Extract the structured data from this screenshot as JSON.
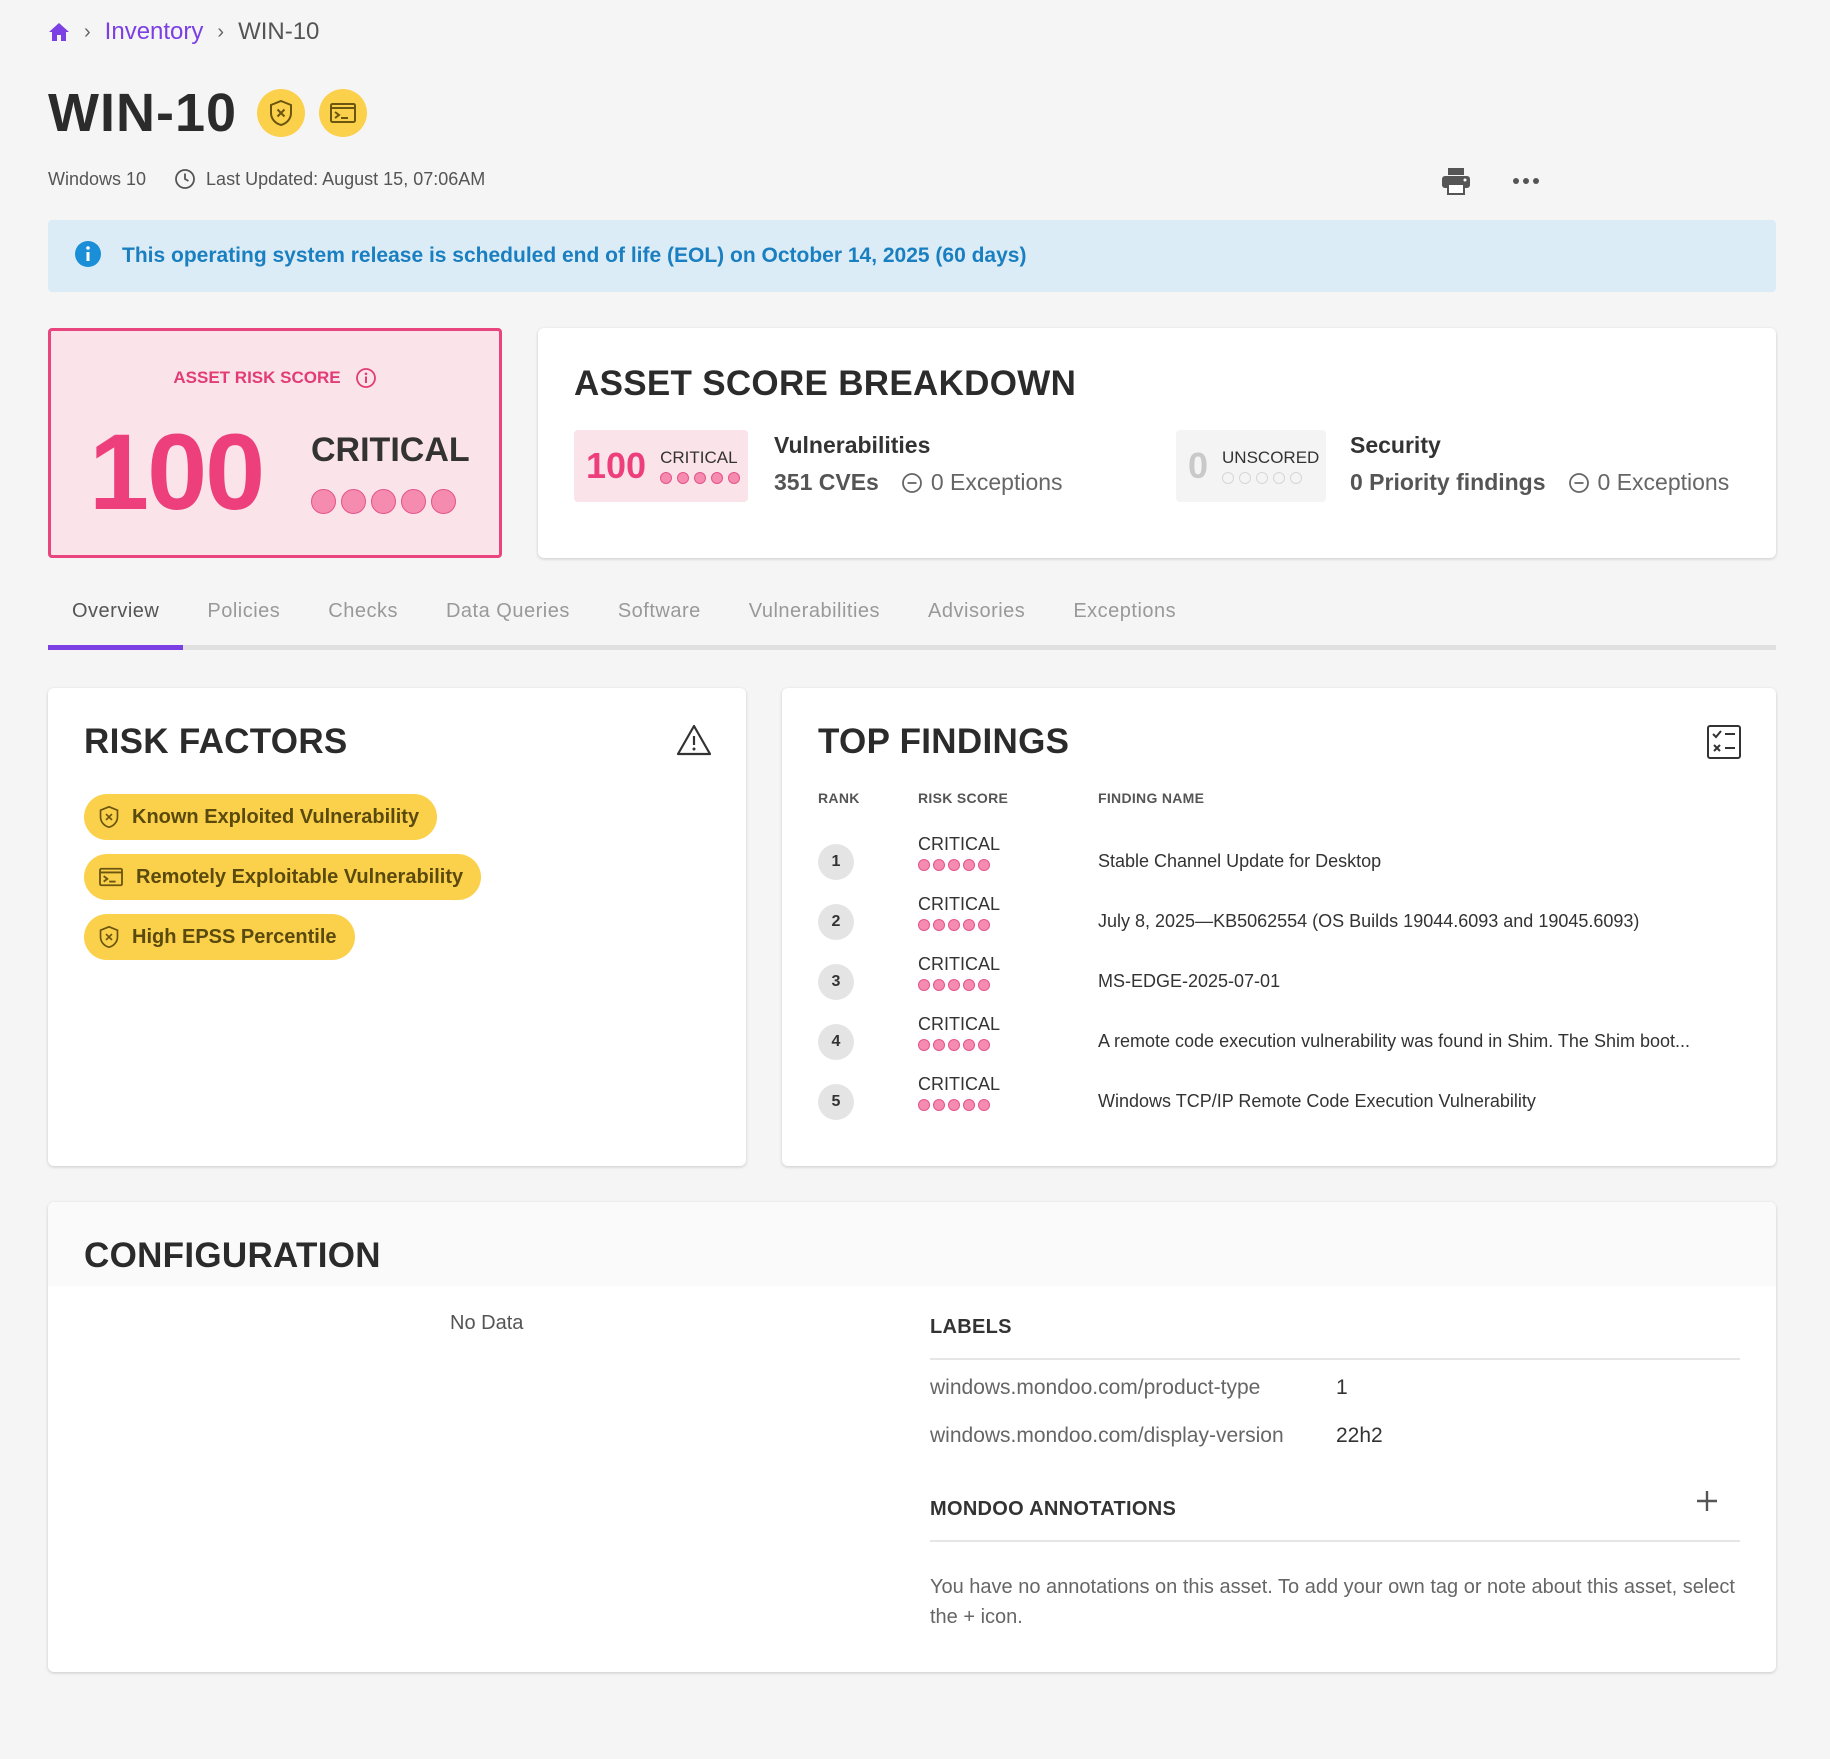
{
  "breadcrumb": {
    "home_icon": "home-icon",
    "inventory": "Inventory",
    "current": "WIN-10",
    "separator": "›"
  },
  "asset": {
    "title": "WIN-10",
    "badges": [
      "known-exploited-shield-icon",
      "remote-terminal-icon"
    ],
    "os": "Windows 10",
    "last_updated": "Last Updated: August 15, 07:06AM"
  },
  "actions": {
    "print_icon": "printer-icon",
    "more_icon": "more-horizontal-icon"
  },
  "eol_banner": {
    "text": "This operating system release is scheduled end of life (EOL) on October 14, 2025 (60 days)",
    "icon": "info-icon"
  },
  "risk_score": {
    "label": "ASSET RISK SCORE",
    "score": "100",
    "rating": "CRITICAL",
    "filled_dots": 5,
    "total_dots": 5
  },
  "breakdown": {
    "title": "ASSET SCORE BREAKDOWN",
    "vulnerabilities": {
      "score": "100",
      "rating": "CRITICAL",
      "filled_dots": 5,
      "title": "Vulnerabilities",
      "count": "351 CVEs",
      "exceptions": "0 Exceptions"
    },
    "security": {
      "score": "0",
      "rating": "UNSCORED",
      "filled_dots": 0,
      "title": "Security",
      "count": "0 Priority findings",
      "exceptions": "0 Exceptions"
    }
  },
  "tabs": [
    "Overview",
    "Policies",
    "Checks",
    "Data Queries",
    "Software",
    "Vulnerabilities",
    "Advisories",
    "Exceptions"
  ],
  "active_tab": "Overview",
  "risk_factors": {
    "title": "RISK FACTORS",
    "items": [
      {
        "label": "Known Exploited Vulnerability",
        "icon": "shield-x-icon"
      },
      {
        "label": "Remotely Exploitable Vulnerability",
        "icon": "terminal-icon"
      },
      {
        "label": "High EPSS Percentile",
        "icon": "shield-x-icon"
      }
    ]
  },
  "top_findings": {
    "title": "TOP FINDINGS",
    "columns": {
      "rank": "RANK",
      "risk": "RISK SCORE",
      "name": "FINDING NAME"
    },
    "rows": [
      {
        "rank": "1",
        "rating": "CRITICAL",
        "name": "Stable Channel Update for Desktop"
      },
      {
        "rank": "2",
        "rating": "CRITICAL",
        "name": "July 8, 2025—KB5062554 (OS Builds 19044.6093 and 19045.6093)"
      },
      {
        "rank": "3",
        "rating": "CRITICAL",
        "name": "MS-EDGE-2025-07-01"
      },
      {
        "rank": "4",
        "rating": "CRITICAL",
        "name": "A remote code execution vulnerability was found in Shim. The Shim boot..."
      },
      {
        "rank": "5",
        "rating": "CRITICAL",
        "name": "Windows TCP/IP Remote Code Execution Vulnerability"
      }
    ]
  },
  "configuration": {
    "title": "CONFIGURATION",
    "no_data": "No Data",
    "labels_title": "LABELS",
    "labels": [
      {
        "key": "windows.mondoo.com/product-type",
        "value": "1"
      },
      {
        "key": "windows.mondoo.com/display-version",
        "value": "22h2"
      }
    ],
    "annotations_title": "MONDOO ANNOTATIONS",
    "annotations_text": "You have no annotations on this asset. To add your own tag or note about this asset, select the + icon."
  },
  "colors": {
    "accent": "#7b3fe4",
    "critical": "#ec3f7b",
    "critical_bg": "#fbe3ea",
    "risk_chip": "#fbd04b",
    "info": "#1a7fc0",
    "info_bg": "#dcecf6"
  }
}
